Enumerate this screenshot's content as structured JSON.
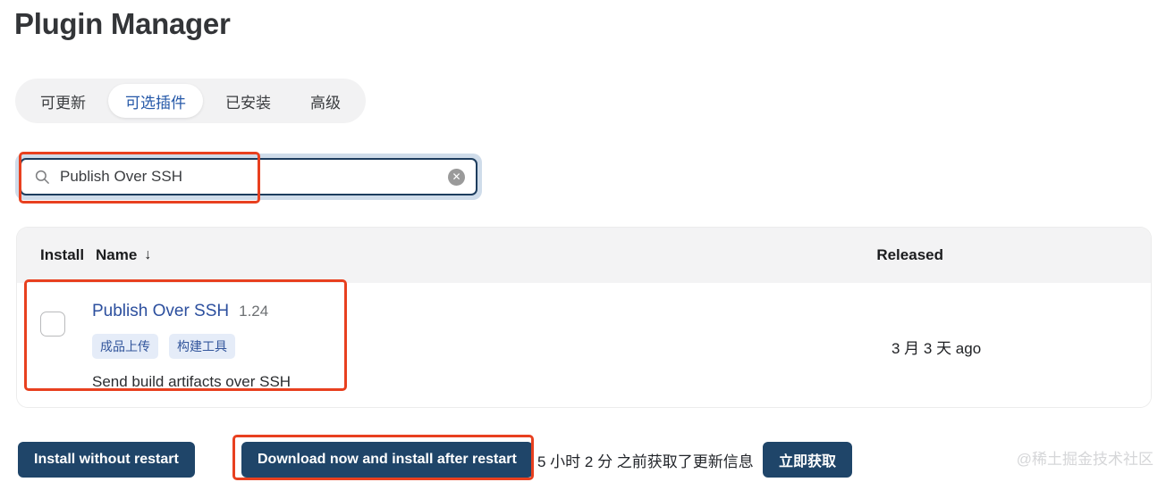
{
  "page": {
    "title": "Plugin Manager",
    "watermark": "@稀土掘金技术社区"
  },
  "tabs": [
    {
      "label": "可更新",
      "active": false
    },
    {
      "label": "可选插件",
      "active": true
    },
    {
      "label": "已安装",
      "active": false
    },
    {
      "label": "高级",
      "active": false
    }
  ],
  "search": {
    "icon": "search-icon",
    "value": "Publish Over SSH",
    "placeholder": "",
    "clear_label": "✕"
  },
  "table": {
    "headers": {
      "install": "Install",
      "name": "Name",
      "sort_indicator": "↓",
      "released": "Released"
    },
    "rows": [
      {
        "checked": false,
        "name": "Publish Over SSH",
        "version": "1.24",
        "tags": [
          "成品上传",
          "构建工具"
        ],
        "description": "Send build artifacts over SSH",
        "released": "3 月 3 天 ago"
      }
    ]
  },
  "footer": {
    "install_without_restart": "Install without restart",
    "download_and_install_after_restart": "Download now and install after restart",
    "update_status": "5 小时 2 分 之前获取了更新信息",
    "fetch_now": "立即获取"
  },
  "colors": {
    "accent_blue": "#2c4f9e",
    "button_navy": "#1f4569",
    "annotation_red": "#e8401f",
    "tag_bg": "#e5ecf8",
    "header_bg": "#f3f3f4"
  }
}
